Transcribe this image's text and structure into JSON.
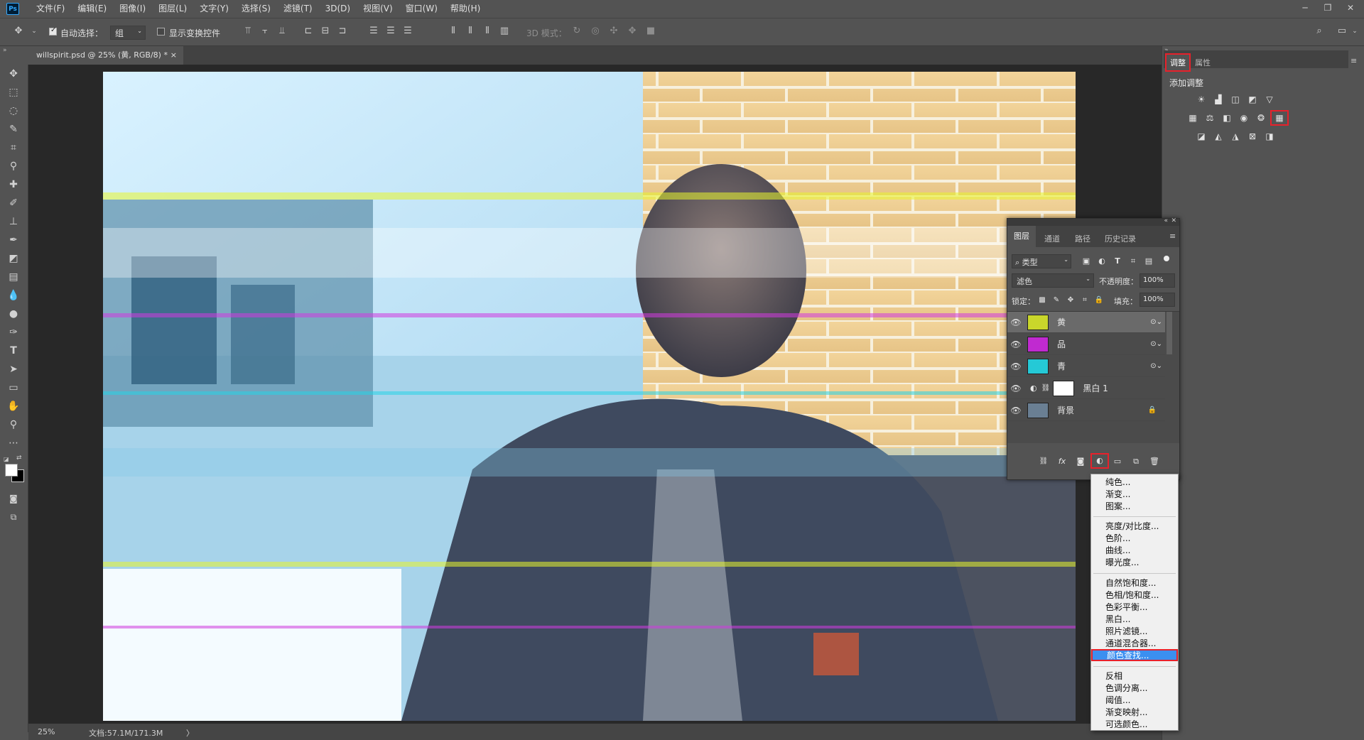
{
  "app": {
    "logo": "Ps"
  },
  "menu": [
    "文件(F)",
    "编辑(E)",
    "图像(I)",
    "图层(L)",
    "文字(Y)",
    "选择(S)",
    "滤镜(T)",
    "3D(D)",
    "视图(V)",
    "窗口(W)",
    "帮助(H)"
  ],
  "window_controls": [
    "minimize-icon",
    "restore-icon",
    "close-icon"
  ],
  "options": {
    "auto_select_label": "自动选择：",
    "auto_select_checked": true,
    "auto_select_value": "组",
    "show_transform_label": "显示变换控件",
    "mode_3d_label": "3D 模式："
  },
  "document": {
    "tab_title": "willspirit.psd @ 25% (黄, RGB/8) *",
    "close_symbol": "×"
  },
  "status": {
    "zoom": "25%",
    "doc_info": "文档:57.1M/171.3M",
    "arrow": "〉"
  },
  "adjust_panel": {
    "tabs": [
      "调整",
      "属性"
    ],
    "active_tab": "调整",
    "title": "添加调整"
  },
  "layers_panel": {
    "tabs": [
      "图层",
      "通道",
      "路径",
      "历史记录"
    ],
    "active_tab": "图层",
    "filter_kind": "类型",
    "blend_mode": "滤色",
    "opacity_label": "不透明度：",
    "opacity_value": "100%",
    "lock_label": "锁定：",
    "fill_label": "填充：",
    "fill_value": "100%",
    "layers": [
      {
        "name": "黄",
        "thumb": "#c9d62b",
        "selected": true,
        "smart": true
      },
      {
        "name": "品",
        "thumb": "#c02ad0",
        "selected": false,
        "smart": true
      },
      {
        "name": "青",
        "thumb": "#25c9d6",
        "selected": false,
        "smart": true
      },
      {
        "name": "黑白 1",
        "thumb": "#ffffff",
        "selected": false,
        "smart": false,
        "adjustment": true
      },
      {
        "name": "背景",
        "thumb": "#6a7f93",
        "selected": false,
        "smart": false,
        "locked": true
      }
    ]
  },
  "adjust_menu": {
    "group1": [
      "纯色...",
      "渐变...",
      "图案..."
    ],
    "group2": [
      "亮度/对比度...",
      "色阶...",
      "曲线...",
      "曝光度..."
    ],
    "group3": [
      "自然饱和度...",
      "色相/饱和度...",
      "色彩平衡...",
      "黑白...",
      "照片滤镜...",
      "通道混合器...",
      "颜色查找..."
    ],
    "group4": [
      "反相",
      "色调分离...",
      "阈值...",
      "渐变映射...",
      "可选颜色..."
    ],
    "highlighted": "颜色查找..."
  },
  "colors": {
    "accent_red": "#e8212b",
    "menu_highlight": "#3b8ff0",
    "app_bg": "#535353",
    "canvas_bg": "#282828"
  }
}
